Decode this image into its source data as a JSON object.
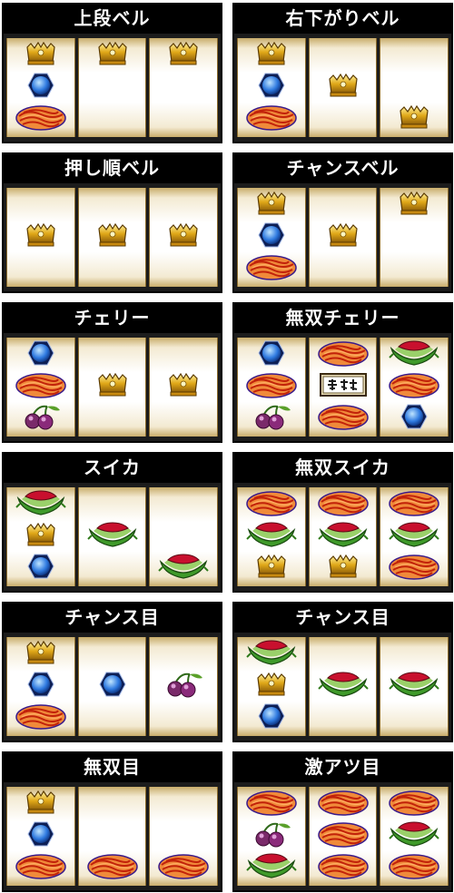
{
  "panels": [
    {
      "title": "上段ベル",
      "reels": [
        [
          "bell",
          "replay",
          "spaghetti"
        ],
        [
          "bell",
          "",
          ""
        ],
        [
          "bell",
          "",
          ""
        ]
      ]
    },
    {
      "title": "右下がりベル",
      "reels": [
        [
          "bell",
          "replay",
          "spaghetti"
        ],
        [
          "",
          "bell",
          ""
        ],
        [
          "",
          "",
          "bell"
        ]
      ]
    },
    {
      "title": "押し順ベル",
      "reels": [
        [
          "",
          "bell",
          ""
        ],
        [
          "",
          "bell",
          ""
        ],
        [
          "",
          "bell",
          ""
        ]
      ]
    },
    {
      "title": "チャンスベル",
      "reels": [
        [
          "bell",
          "replay",
          "spaghetti"
        ],
        [
          "",
          "bell",
          ""
        ],
        [
          "bell",
          "",
          ""
        ]
      ]
    },
    {
      "title": "チェリー",
      "reels": [
        [
          "replay",
          "spaghetti",
          "cherry"
        ],
        [
          "",
          "bell",
          ""
        ],
        [
          "",
          "bell",
          ""
        ]
      ]
    },
    {
      "title": "無双チェリー",
      "reels": [
        [
          "replay",
          "spaghetti",
          "cherry"
        ],
        [
          "spaghetti",
          "musou",
          "spaghetti"
        ],
        [
          "watermelon",
          "spaghetti",
          "replay"
        ]
      ]
    },
    {
      "title": "スイカ",
      "reels": [
        [
          "watermelon",
          "bell",
          "replay"
        ],
        [
          "",
          "watermelon",
          ""
        ],
        [
          "",
          "",
          "watermelon"
        ]
      ]
    },
    {
      "title": "無双スイカ",
      "reels": [
        [
          "spaghetti",
          "watermelon",
          "bell"
        ],
        [
          "spaghetti",
          "watermelon",
          "bell"
        ],
        [
          "spaghetti",
          "watermelon",
          "spaghetti"
        ]
      ]
    },
    {
      "title": "チャンス目",
      "reels": [
        [
          "bell",
          "replay",
          "spaghetti"
        ],
        [
          "",
          "replay",
          ""
        ],
        [
          "",
          "cherry",
          ""
        ]
      ]
    },
    {
      "title": "チャンス目",
      "reels": [
        [
          "watermelon",
          "bell",
          "replay"
        ],
        [
          "",
          "watermelon",
          ""
        ],
        [
          "",
          "watermelon",
          ""
        ]
      ]
    },
    {
      "title": "無双目",
      "reels": [
        [
          "bell",
          "replay",
          "spaghetti"
        ],
        [
          "",
          "",
          "spaghetti"
        ],
        [
          "",
          "",
          "spaghetti"
        ]
      ]
    },
    {
      "title": "激アツ目",
      "reels": [
        [
          "spaghetti",
          "cherry",
          "watermelon"
        ],
        [
          "spaghetti",
          "spaghetti",
          "spaghetti"
        ],
        [
          "spaghetti",
          "watermelon",
          "spaghetti"
        ]
      ]
    }
  ],
  "colors": {
    "panel_bg": "#000000",
    "title_text": "#ffffff",
    "reel_gold": "#c9ad6b",
    "bell": "#d9a31a",
    "replay": "#1f5fd1",
    "spaghetti": "#e04a14",
    "watermelon": "#3f9a2a",
    "cherry": "#7a2a6a"
  }
}
